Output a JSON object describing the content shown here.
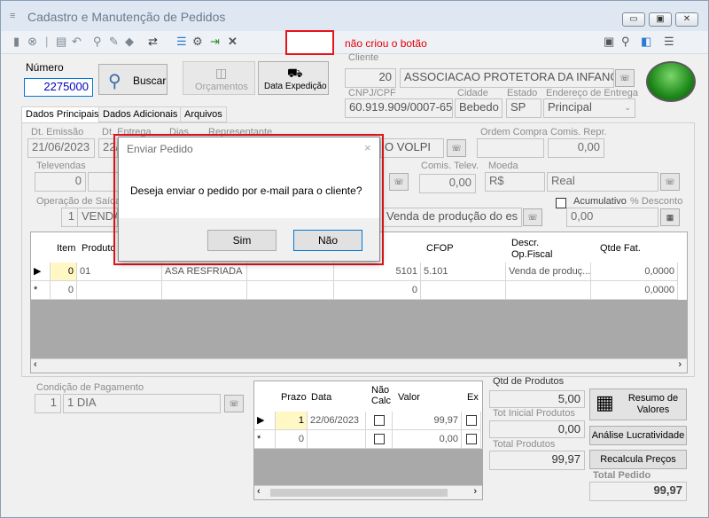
{
  "window": {
    "title": "Cadastro e Manutenção de Pedidos",
    "controls": [
      "▭",
      "▣",
      "✕"
    ]
  },
  "toolbar": {
    "icons": [
      "▮",
      "⊗",
      "▤",
      "↶",
      "⚲",
      "✎",
      "◆",
      "⇄",
      "☰",
      "⚙",
      "⇥",
      "✕"
    ],
    "annotation": "não criou o botão",
    "right_icons": [
      "▣",
      "⚲",
      "◧",
      "☰"
    ]
  },
  "numero": {
    "label": "Número",
    "value": "2275000",
    "buscar_label": "Buscar"
  },
  "buttons": {
    "orcamentos": "Orçamentos",
    "data_expedicao": "Data Expedição"
  },
  "cliente": {
    "label": "Cliente",
    "code": "20",
    "name": "ASSOCIACAO PROTETORA DA INFANC",
    "cnpj_label": "CNPJ/CPF",
    "cnpj": "60.919.909/0007-65",
    "cidade_label": "Cidade",
    "cidade": "Bebedo",
    "estado_label": "Estado",
    "estado": "SP",
    "entrega_label": "Endereço de Entrega",
    "entrega": "Principal"
  },
  "tabs": [
    "Dados Principais",
    "Dados Adicionais",
    "Arquivos"
  ],
  "dados": {
    "emissao_label": "Dt. Emissão",
    "emissao": "21/06/2023",
    "entrega_label": "Dt. Entrega",
    "entrega_value": "22/",
    "dias_label": "Dias",
    "representante_label": "Representante",
    "representante_value": "O VOLPI",
    "ordem_label": "Ordem Compra",
    "comis_repr_label": "Comis. Repr.",
    "comis_repr": "0,00",
    "televendas_label": "Televendas",
    "televendas": "0",
    "comis_telev_label": "Comis. Telev.",
    "comis_telev": "0,00",
    "moeda_label": "Moeda",
    "moeda_code": "R$",
    "moeda_name": "Real",
    "operacao_label": "Operação de Saída",
    "operacao_code": "1",
    "operacao_name": "VENDA",
    "operacao_desc": "Venda de produção do es",
    "acumulativo_label": "Acumulativo",
    "desconto_label": "% Desconto",
    "desconto": "0,00"
  },
  "items_grid": {
    "headers": {
      "item": "Item",
      "produto": "Produto",
      "cfop": "CFOP",
      "descr": "Descr. Op.Fiscal",
      "qtde": "Qtde Fat."
    },
    "rows": [
      {
        "marker": "▶",
        "item": "0",
        "produto": "01",
        "desc": "ASA RESFRIADA",
        "valor": "5101",
        "cfop": "5.101",
        "descr": "Venda de produç...",
        "qtde": "0,0000"
      },
      {
        "marker": "*",
        "item": "0",
        "produto": "",
        "desc": "",
        "valor": "0",
        "cfop": "",
        "descr": "",
        "qtde": "0,0000"
      }
    ]
  },
  "pagamento": {
    "label": "Condição de Pagamento",
    "code": "1",
    "name": "1 DIA"
  },
  "prazo_grid": {
    "headers": {
      "prazo": "Prazo",
      "data": "Data",
      "nao_calc": "Não Calc",
      "valor": "Valor",
      "ex": "Ex"
    },
    "rows": [
      {
        "marker": "▶",
        "prazo": "1",
        "data": "22/06/2023",
        "valor": "99,97"
      },
      {
        "marker": "*",
        "prazo": "0",
        "data": "",
        "valor": "0,00"
      }
    ]
  },
  "totais": {
    "qtd_label": "Qtd de Produtos",
    "qtd": "5,00",
    "total_inicial_label": "Tot Inicial Produtos",
    "total_inicial": "0,00",
    "total_produtos_label": "Total Produtos",
    "total_produtos": "99,97",
    "total_pedido_label": "Total Pedido",
    "total_pedido": "99,97",
    "resumo_label": "Resumo de Valores",
    "analise_label": "Análise Lucratividade",
    "recalcula_label": "Recalcula Preços"
  },
  "dialog": {
    "title": "Enviar Pedido",
    "message": "Deseja enviar o pedido por e-mail para o cliente?",
    "yes": "Sim",
    "no": "Não"
  },
  "colors": {
    "highlight": "#e8131b",
    "focus_blue": "#0078d7",
    "annotation_red": "#e00000"
  }
}
